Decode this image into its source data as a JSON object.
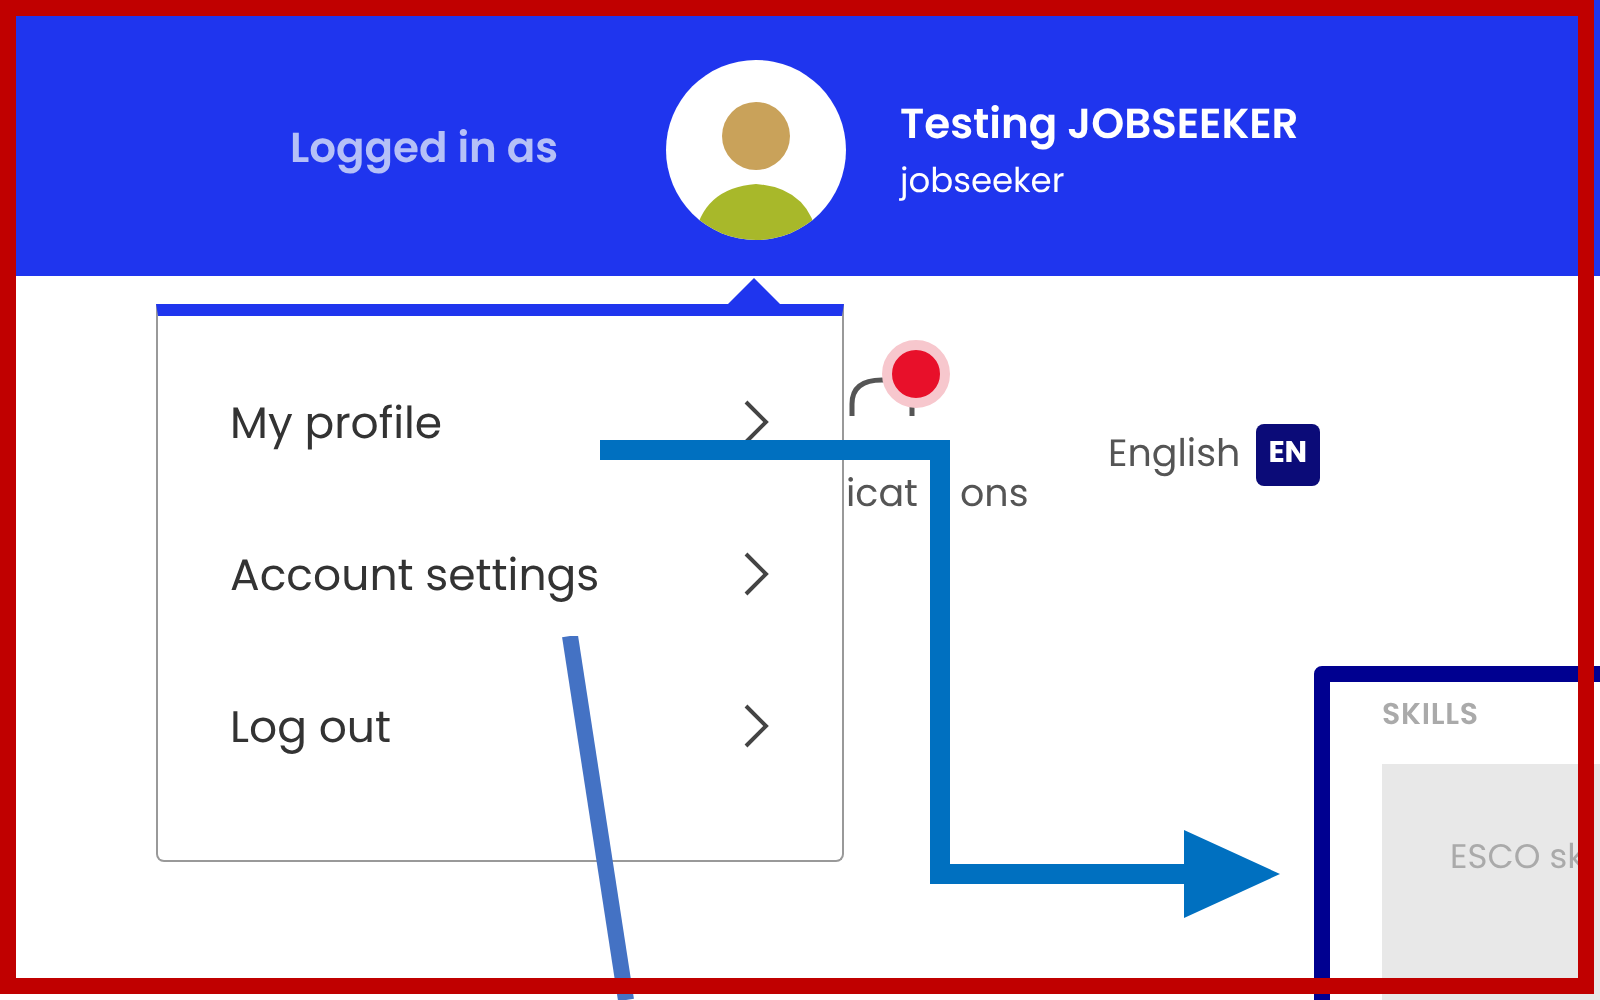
{
  "header": {
    "label": "Logged in as",
    "user_name": "Testing JOBSEEKER",
    "username": "jobseeker"
  },
  "user_menu": {
    "items": [
      {
        "label": "My profile"
      },
      {
        "label": "Account settings"
      },
      {
        "label": "Log out"
      }
    ]
  },
  "notifications": {
    "label_parts": [
      "icat",
      "ons"
    ],
    "unread": true
  },
  "language": {
    "label": "English",
    "code": "EN"
  },
  "inset": {
    "section_title": "SKILLS",
    "field_text": "ESCO sk"
  }
}
